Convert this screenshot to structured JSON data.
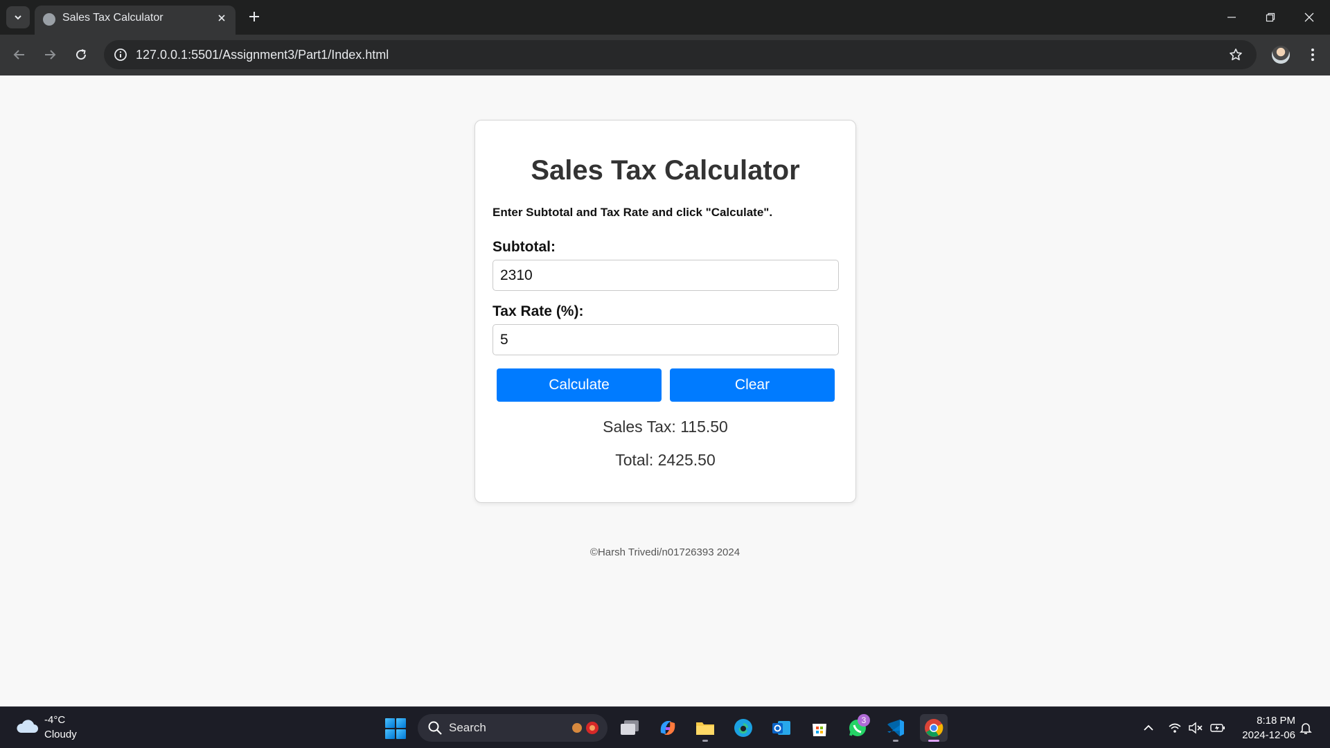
{
  "browser": {
    "tab_title": "Sales Tax Calculator",
    "url": "127.0.0.1:5501/Assignment3/Part1/Index.html"
  },
  "page": {
    "heading": "Sales Tax Calculator",
    "instructions": "Enter Subtotal and Tax Rate and click \"Calculate\".",
    "subtotal_label": "Subtotal:",
    "subtotal_value": "2310",
    "tax_rate_label": "Tax Rate (%):",
    "tax_rate_value": "5",
    "calculate_label": "Calculate",
    "clear_label": "Clear",
    "sales_tax_text": "Sales Tax: 115.50",
    "total_text": "Total: 2425.50",
    "footer": "©Harsh Trivedi/n01726393 2024"
  },
  "colors": {
    "accent": "#007bff",
    "heading": "#333333",
    "page_background": "#f8f8f8"
  },
  "taskbar": {
    "weather_temp": "-4°C",
    "weather_condition": "Cloudy",
    "search_label": "Search",
    "whatsapp_badge": "3",
    "time": "8:18 PM",
    "date": "2024-12-06",
    "apps": [
      "task-view",
      "copilot",
      "file-explorer",
      "edge",
      "outlook",
      "microsoft-store",
      "whatsapp",
      "vscode",
      "chrome"
    ]
  }
}
